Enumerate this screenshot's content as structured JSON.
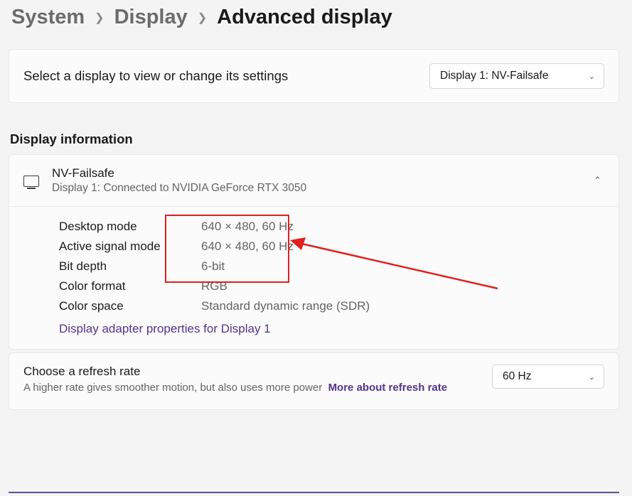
{
  "breadcrumb": {
    "level1": "System",
    "level2": "Display",
    "current": "Advanced display"
  },
  "display_selector": {
    "label": "Select a display to view or change its settings",
    "selected": "Display 1: NV-Failsafe"
  },
  "info_section_heading": "Display information",
  "display_info": {
    "name": "NV-Failsafe",
    "connection": "Display 1: Connected to NVIDIA GeForce RTX 3050",
    "rows": {
      "desktop_mode": {
        "label": "Desktop mode",
        "value": "640 × 480, 60 Hz"
      },
      "active_signal_mode": {
        "label": "Active signal mode",
        "value": "640 × 480, 60 Hz"
      },
      "bit_depth": {
        "label": "Bit depth",
        "value": "6-bit"
      },
      "color_format": {
        "label": "Color format",
        "value": "RGB"
      },
      "color_space": {
        "label": "Color space",
        "value": "Standard dynamic range (SDR)"
      }
    },
    "adapter_link": "Display adapter properties for Display 1"
  },
  "refresh": {
    "title": "Choose a refresh rate",
    "desc": "A higher rate gives smoother motion, but also uses more power",
    "more_link": "More about refresh rate",
    "selected": "60 Hz"
  }
}
